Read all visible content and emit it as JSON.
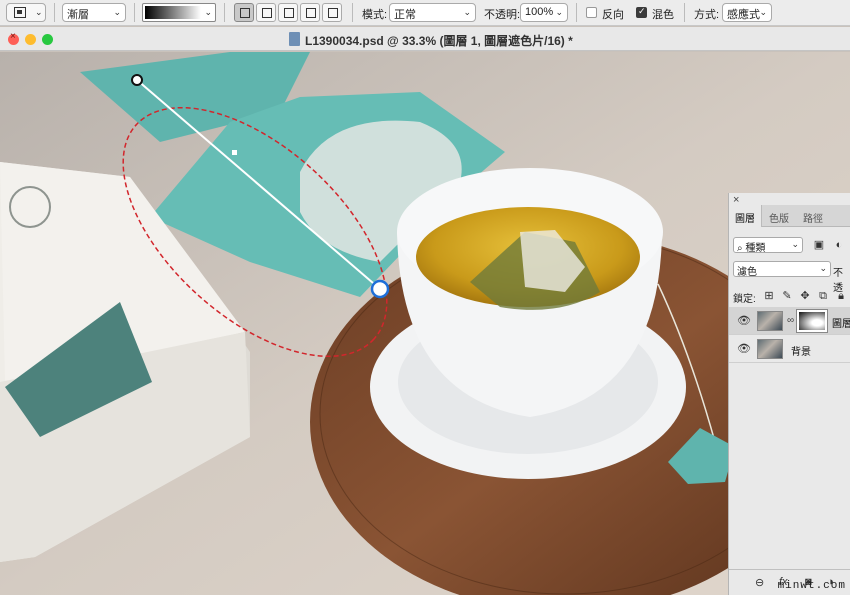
{
  "options_bar": {
    "mode_select": "漸層",
    "gradient_types": [
      "linear",
      "radial",
      "angle",
      "reflected",
      "diamond"
    ],
    "mode_label": "模式:",
    "mode_value": "正常",
    "opacity_label": "不透明:",
    "opacity_value": "100%",
    "reverse_label": "反向",
    "reverse_checked": false,
    "dither_label": "混色",
    "dither_checked": true,
    "method_label": "方式:",
    "method_value": "感應式"
  },
  "window": {
    "title": "L1390034.psd @ 33.3% (圖層 1, 圖層遮色片/16) *"
  },
  "canvas": {
    "gradient_drag_handles": [
      "start-handle",
      "end-handle"
    ],
    "selection": "elliptical-marquee"
  },
  "layers_panel": {
    "tabs": [
      "圖層",
      "色版",
      "路徑"
    ],
    "active_tab": "圖層",
    "filter_select": "種類",
    "blend_select": "濾色",
    "opacity_label": "不透",
    "lock_label": "鎖定:",
    "layers": [
      {
        "name": "圖層",
        "has_mask": true,
        "selected": true
      },
      {
        "name": "背景",
        "has_mask": false,
        "selected": false
      }
    ],
    "footer_icons": [
      "link-icon",
      "fx-icon",
      "mask-icon",
      "adjustment-icon"
    ]
  },
  "watermark": "minwt.com",
  "colors": {
    "accent_teal": "#5fb4ad",
    "selection_dash": "#d2262c",
    "handle_blue": "#1e6fd9"
  }
}
